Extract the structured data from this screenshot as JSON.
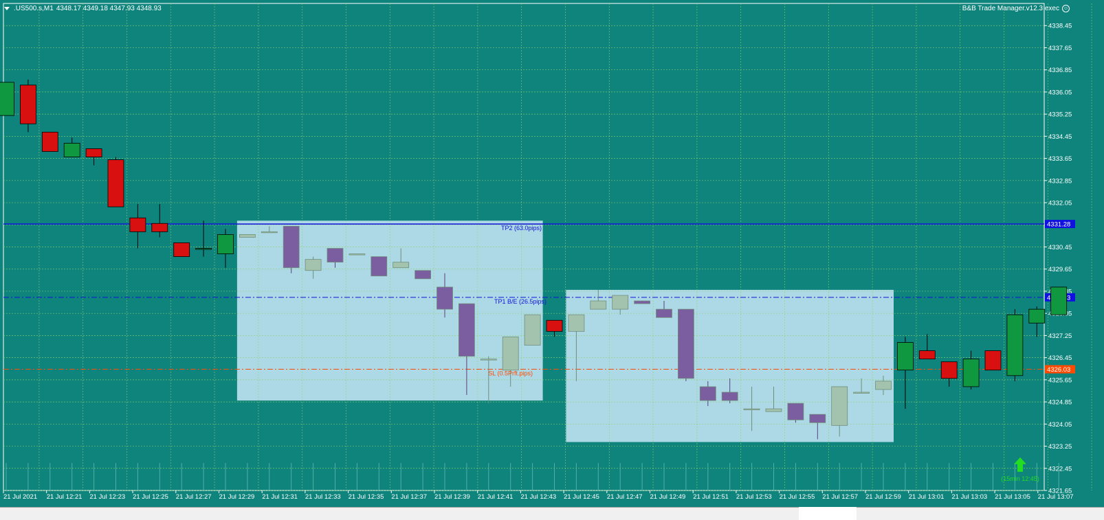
{
  "symbol_header": {
    "symbol": ".US500.s,M1",
    "ohlc": "4348.17 4349.18 4347.93 4348.93"
  },
  "ea": {
    "name": "B&B Trade Manager.v12.3 exec"
  },
  "colors": {
    "background": "#0f847c",
    "grid": "#8fd36a",
    "bull": "#109840",
    "bear": "#d81010",
    "zone_fill": "#add8e6",
    "zone_bull": "#a3c3ae",
    "zone_bear": "#7a5ea0",
    "tp2": "#1010e0",
    "tp1": "#1010e0",
    "sl": "#ff4a00",
    "arrow": "#22dd22"
  },
  "chart_data": {
    "type": "candlestick",
    "timeframe": "M1",
    "price_axis": {
      "ticks": [
        "4338.45",
        "4337.65",
        "4336.85",
        "4336.05",
        "4335.25",
        "4334.45",
        "4333.65",
        "4332.85",
        "4332.05",
        "4331.25",
        "4330.45",
        "4329.65",
        "4328.85",
        "4328.05",
        "4327.25",
        "4326.45",
        "4325.65",
        "4324.85",
        "4324.05",
        "4323.25",
        "4322.45",
        "4321.65"
      ]
    },
    "time_axis": {
      "labels": [
        "21 Jul 2021",
        "21 Jul 12:21",
        "21 Jul 12:23",
        "21 Jul 12:25",
        "21 Jul 12:27",
        "21 Jul 12:29",
        "21 Jul 12:31",
        "21 Jul 12:33",
        "21 Jul 12:35",
        "21 Jul 12:37",
        "21 Jul 12:39",
        "21 Jul 12:41",
        "21 Jul 12:43",
        "21 Jul 12:45",
        "21 Jul 12:47",
        "21 Jul 12:49",
        "21 Jul 12:51",
        "21 Jul 12:53",
        "21 Jul 12:55",
        "21 Jul 12:57",
        "21 Jul 12:59",
        "21 Jul 13:01",
        "21 Jul 13:03",
        "21 Jul 13:05",
        "21 Jul 13:07"
      ]
    },
    "candles": [
      {
        "o": 4335.2,
        "h": 4336.3,
        "l": 4335.2,
        "c": 4336.4
      },
      {
        "o": 4336.3,
        "h": 4336.5,
        "l": 4334.6,
        "c": 4334.9
      },
      {
        "o": 4334.6,
        "h": 4334.6,
        "l": 4333.9,
        "c": 4333.9
      },
      {
        "o": 4333.7,
        "h": 4334.4,
        "l": 4333.7,
        "c": 4334.2
      },
      {
        "o": 4334.0,
        "h": 4334.0,
        "l": 4333.4,
        "c": 4333.7
      },
      {
        "o": 4333.6,
        "h": 4333.7,
        "l": 4331.9,
        "c": 4331.9
      },
      {
        "o": 4331.5,
        "h": 4332.0,
        "l": 4330.4,
        "c": 4331.0
      },
      {
        "o": 4331.3,
        "h": 4332.0,
        "l": 4330.8,
        "c": 4331.0
      },
      {
        "o": 4330.6,
        "h": 4330.6,
        "l": 4330.2,
        "c": 4330.1
      },
      {
        "o": 4330.4,
        "h": 4331.4,
        "l": 4330.1,
        "c": 4330.4
      },
      {
        "o": 4330.2,
        "h": 4331.1,
        "l": 4329.7,
        "c": 4330.9
      },
      {
        "o": 4330.8,
        "h": 4330.8,
        "l": 4330.8,
        "c": 4330.9
      },
      {
        "o": 4331.0,
        "h": 4331.2,
        "l": 4331.0,
        "c": 4331.0
      },
      {
        "o": 4331.2,
        "h": 4331.2,
        "l": 4329.5,
        "c": 4329.7
      },
      {
        "o": 4329.6,
        "h": 4330.1,
        "l": 4329.3,
        "c": 4330.0
      },
      {
        "o": 4330.4,
        "h": 4330.4,
        "l": 4329.7,
        "c": 4329.9
      },
      {
        "o": 4330.2,
        "h": 4330.2,
        "l": 4330.2,
        "c": 4330.2
      },
      {
        "o": 4330.1,
        "h": 4330.1,
        "l": 4329.4,
        "c": 4329.4
      },
      {
        "o": 4329.7,
        "h": 4330.4,
        "l": 4329.7,
        "c": 4329.9
      },
      {
        "o": 4329.6,
        "h": 4329.6,
        "l": 4329.3,
        "c": 4329.3
      },
      {
        "o": 4329.0,
        "h": 4329.5,
        "l": 4327.9,
        "c": 4328.2
      },
      {
        "o": 4328.4,
        "h": 4328.4,
        "l": 4325.1,
        "c": 4326.5
      },
      {
        "o": 4326.4,
        "h": 4326.5,
        "l": 4324.8,
        "c": 4326.4
      },
      {
        "o": 4326.0,
        "h": 4327.2,
        "l": 4325.4,
        "c": 4327.2
      },
      {
        "o": 4326.9,
        "h": 4328.0,
        "l": 4326.9,
        "c": 4328.0
      },
      {
        "o": 4327.8,
        "h": 4327.8,
        "l": 4327.2,
        "c": 4327.4
      },
      {
        "o": 4327.4,
        "h": 4328.0,
        "l": 4325.6,
        "c": 4328.0
      },
      {
        "o": 4328.2,
        "h": 4328.9,
        "l": 4328.2,
        "c": 4328.5
      },
      {
        "o": 4328.2,
        "h": 4328.7,
        "l": 4328.0,
        "c": 4328.7
      },
      {
        "o": 4328.5,
        "h": 4328.5,
        "l": 4328.4,
        "c": 4328.4
      },
      {
        "o": 4328.2,
        "h": 4328.5,
        "l": 4327.9,
        "c": 4327.9
      },
      {
        "o": 4328.2,
        "h": 4328.2,
        "l": 4325.6,
        "c": 4325.7
      },
      {
        "o": 4325.4,
        "h": 4325.6,
        "l": 4324.7,
        "c": 4324.9
      },
      {
        "o": 4325.2,
        "h": 4325.7,
        "l": 4324.8,
        "c": 4324.9
      },
      {
        "o": 4324.6,
        "h": 4325.4,
        "l": 4323.8,
        "c": 4324.6
      },
      {
        "o": 4324.5,
        "h": 4325.4,
        "l": 4324.5,
        "c": 4324.6
      },
      {
        "o": 4324.8,
        "h": 4324.8,
        "l": 4324.1,
        "c": 4324.2
      },
      {
        "o": 4324.4,
        "h": 4324.4,
        "l": 4323.5,
        "c": 4324.1
      },
      {
        "o": 4324.0,
        "h": 4325.4,
        "l": 4323.6,
        "c": 4325.4
      },
      {
        "o": 4325.2,
        "h": 4325.7,
        "l": 4325.2,
        "c": 4325.2
      },
      {
        "o": 4325.3,
        "h": 4325.8,
        "l": 4325.1,
        "c": 4325.6
      },
      {
        "o": 4326.0,
        "h": 4327.2,
        "l": 4324.6,
        "c": 4327.0
      },
      {
        "o": 4326.7,
        "h": 4327.3,
        "l": 4326.4,
        "c": 4326.4
      },
      {
        "o": 4326.3,
        "h": 4326.3,
        "l": 4325.4,
        "c": 4325.7
      },
      {
        "o": 4325.4,
        "h": 4326.7,
        "l": 4325.3,
        "c": 4326.4
      },
      {
        "o": 4326.7,
        "h": 4326.7,
        "l": 4326.0,
        "c": 4326.0
      },
      {
        "o": 4325.8,
        "h": 4328.2,
        "l": 4325.6,
        "c": 4328.0
      },
      {
        "o": 4327.7,
        "h": 4328.3,
        "l": 4327.2,
        "c": 4328.2
      },
      {
        "o": 4328.0,
        "h": 4329.0,
        "l": 4328.0,
        "c": 4329.0
      }
    ],
    "zones": [
      {
        "name": "zone-1",
        "start_index": 11,
        "end_index": 24,
        "top": 4331.4,
        "bottom": 4324.9
      },
      {
        "name": "zone-2",
        "start_index": 26,
        "end_index": 40,
        "top": 4328.9,
        "bottom": 4323.4
      }
    ],
    "levels": [
      {
        "name": "tp2",
        "price": 4331.28,
        "label": "TP2 (63.0pips)",
        "price_tag": "4331.28",
        "style": "solid"
      },
      {
        "name": "tp1",
        "price": 4328.63,
        "label": "TP1 B/E (26.5pips)",
        "price_tag": "4328.63",
        "style": "dashdot"
      },
      {
        "name": "sl",
        "price": 4326.03,
        "label": "SL (0.5Prft.pips)",
        "price_tag": "4326.03",
        "style": "dashdot"
      }
    ],
    "signal": {
      "type": "buy-arrow",
      "label": "(15min 12:45)",
      "price": 4322.5
    }
  }
}
